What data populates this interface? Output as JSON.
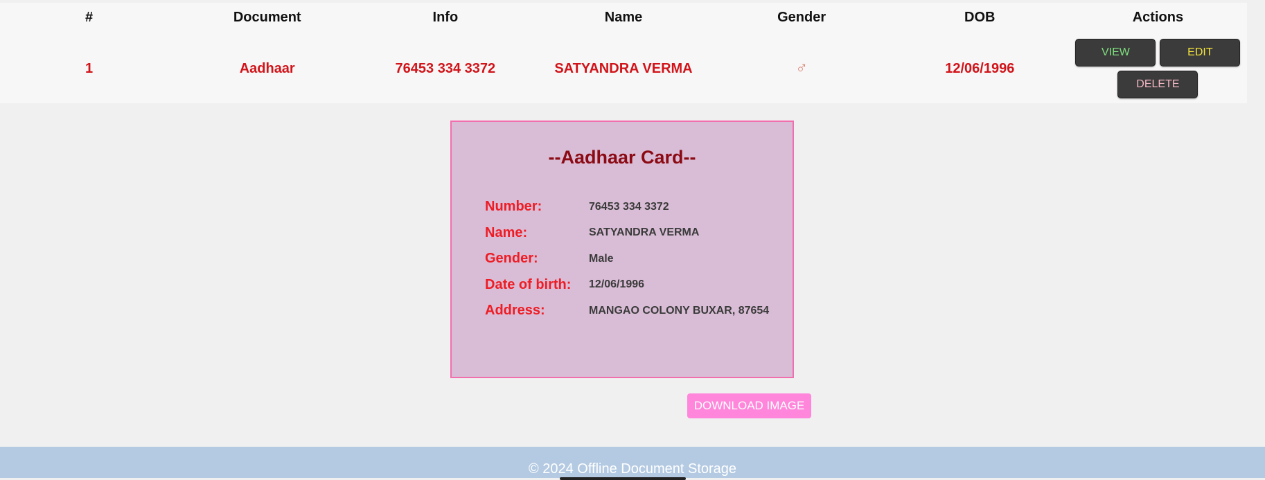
{
  "table": {
    "headers": [
      "#",
      "Document",
      "Info",
      "Name",
      "Gender",
      "DOB",
      "Actions"
    ],
    "rows": [
      {
        "index": "1",
        "document": "Aadhaar",
        "info": "76453 334 3372",
        "name": "SATYANDRA VERMA",
        "gender_symbol": "♂",
        "dob": "12/06/1996",
        "actions": {
          "view_label": "VIEW",
          "edit_label": "EDIT",
          "delete_label": "DELETE"
        }
      }
    ]
  },
  "card": {
    "title": "--Aadhaar Card--",
    "fields": [
      {
        "label": "Number:",
        "value": "76453 334 3372"
      },
      {
        "label": "Name:",
        "value": "SATYANDRA VERMA"
      },
      {
        "label": "Gender:",
        "value": "Male"
      },
      {
        "label": "Date of birth:",
        "value": "12/06/1996"
      },
      {
        "label": "Address:",
        "value": "MANGAO COLONY BUXAR, 87654"
      }
    ]
  },
  "download_label": "DOWNLOAD IMAGE",
  "footer": {
    "text": "© 2024 Offline Document Storage"
  },
  "colors": {
    "row_text": "#d0141a",
    "card_bg": "#d9bdd6",
    "card_border": "#f26fae",
    "card_title": "#8b0a14",
    "field_label": "#ee1c24",
    "download_button": "#ff86db",
    "footer_bg": "#b4cae2",
    "view_text": "#7fe07f",
    "edit_text": "#f5e53a",
    "delete_text": "#f6b8c6"
  },
  "icons": {
    "gender": "male-symbol-icon"
  }
}
